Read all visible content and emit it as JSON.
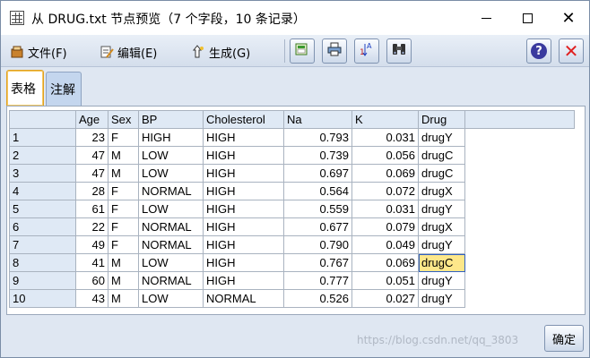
{
  "window": {
    "title": "从 DRUG.txt 节点预览（7 个字段，10 条记录）",
    "controls": {
      "minimize": "—",
      "maximize": "☐",
      "close": "✕"
    }
  },
  "menu": {
    "file": "文件(F)",
    "edit": "编辑(E)",
    "generate": "生成(G)"
  },
  "toolbar": {
    "buttons": [
      "export-icon",
      "print-icon",
      "sort-icon",
      "binoculars-icon"
    ],
    "help": "?",
    "close": "✕"
  },
  "tabs": [
    {
      "label": "表格",
      "active": true
    },
    {
      "label": "注解",
      "active": false
    }
  ],
  "table": {
    "columns": [
      "",
      "Age",
      "Sex",
      "BP",
      "Cholesterol",
      "Na",
      "K",
      "Drug"
    ],
    "rows": [
      [
        "1",
        "23",
        "F",
        "HIGH",
        "HIGH",
        "0.793",
        "0.031",
        "drugY"
      ],
      [
        "2",
        "47",
        "M",
        "LOW",
        "HIGH",
        "0.739",
        "0.056",
        "drugC"
      ],
      [
        "3",
        "47",
        "M",
        "LOW",
        "HIGH",
        "0.697",
        "0.069",
        "drugC"
      ],
      [
        "4",
        "28",
        "F",
        "NORMAL",
        "HIGH",
        "0.564",
        "0.072",
        "drugX"
      ],
      [
        "5",
        "61",
        "F",
        "LOW",
        "HIGH",
        "0.559",
        "0.031",
        "drugY"
      ],
      [
        "6",
        "22",
        "F",
        "NORMAL",
        "HIGH",
        "0.677",
        "0.079",
        "drugX"
      ],
      [
        "7",
        "49",
        "F",
        "NORMAL",
        "HIGH",
        "0.790",
        "0.049",
        "drugY"
      ],
      [
        "8",
        "41",
        "M",
        "LOW",
        "HIGH",
        "0.767",
        "0.069",
        "drugC"
      ],
      [
        "9",
        "60",
        "M",
        "NORMAL",
        "HIGH",
        "0.777",
        "0.051",
        "drugY"
      ],
      [
        "10",
        "43",
        "M",
        "LOW",
        "NORMAL",
        "0.526",
        "0.027",
        "drugY"
      ]
    ],
    "selected_cell": {
      "row": 7,
      "col": 7
    }
  },
  "ok_button": "确定",
  "watermark": "https://blog.csdn.net/qq_3803",
  "colors": {
    "selection": "#fde78a",
    "header": "#dfe9f5",
    "accent_tab": "#e0a020"
  }
}
